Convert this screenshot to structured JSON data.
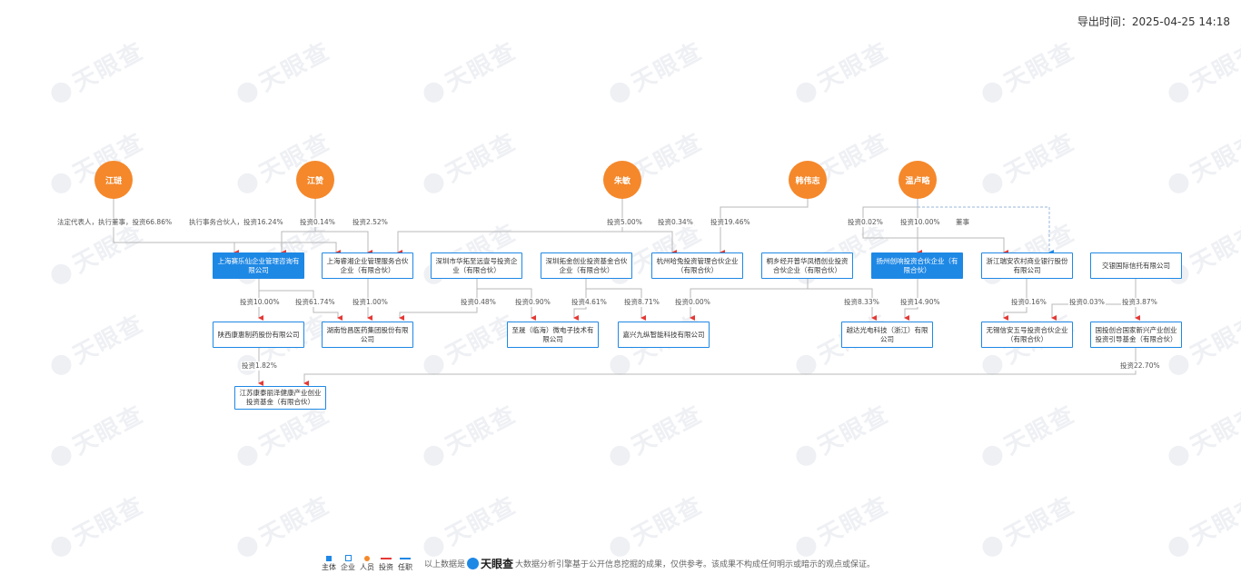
{
  "header": {
    "export_time": "导出时间：2025-04-25 14:18"
  },
  "watermark": {
    "text": "天眼查"
  },
  "persons": [
    {
      "name": "江琎"
    },
    {
      "name": "江赞"
    },
    {
      "name": "朱敏"
    },
    {
      "name": "韩伟志"
    },
    {
      "name": "温卢略"
    }
  ],
  "companies": [
    {
      "name": "上海赛乐仙企业管理咨询有限公司"
    },
    {
      "name": "上海睿湘企业管理服务合伙企业（有限合伙）"
    },
    {
      "name": "深圳市华拓至远壹号投资企业（有限合伙）"
    },
    {
      "name": "深圳拓金创业投资基金合伙企业（有限合伙）"
    },
    {
      "name": "杭州哈兔投资管理合伙企业（有限合伙）"
    },
    {
      "name": "桐乡经开普华凤栖创业投资合伙企业（有限合伙）"
    },
    {
      "name": "扬州创响投资合伙企业（有限合伙）"
    },
    {
      "name": "浙江瑞安农村商业银行股份有限公司"
    },
    {
      "name": "交银国际信托有限公司"
    },
    {
      "name": "陕西康惠制药股份有限公司"
    },
    {
      "name": "湖南怡昌医药集团股份有限公司"
    },
    {
      "name": "至晟（临海）微电子技术有限公司"
    },
    {
      "name": "嘉兴九纵智能科技有限公司"
    },
    {
      "name": "越达光电科技（浙江）有限公司"
    },
    {
      "name": "无锡信安五号投资合伙企业（有限合伙）"
    },
    {
      "name": "国投创合国家新兴产业创业投资引导基金（有限合伙）"
    },
    {
      "name": "江苏康泰丽泽健康产业创业投资基金（有限合伙）"
    }
  ],
  "edge_labels": [
    "法定代表人，执行董事，投资66.86%",
    "执行事务合伙人，投资16.24%",
    "投资0.14%",
    "投资2.52%",
    "投资5.00%",
    "投资0.34%",
    "投资19.46%",
    "投资0.02%",
    "投资10.00%",
    "董事",
    "投资10.00%",
    "投资61.74%",
    "投资1.00%",
    "投资0.48%",
    "投资0.90%",
    "投资4.61%",
    "投资8.71%",
    "投资0.00%",
    "投资8.33%",
    "投资14.90%",
    "投资0.16%",
    "投资0.03%",
    "投资3.87%",
    "投资1.82%",
    "投资22.70%"
  ],
  "footer": {
    "legend": [
      "主体",
      "企业",
      "人员",
      "投资",
      "任职"
    ],
    "prefix": "以上数据是",
    "brand": "天眼查",
    "disclaimer": "大数据分析引擎基于公开信息挖掘的成果，仅供参考。该成果不构成任何明示或暗示的观点或保证。"
  },
  "colors": {
    "person": "#f5882b",
    "company_border": "#1e88e5",
    "main_fill": "#1e88e5",
    "invest_line": "#e53935",
    "position_line": "#1e88e5"
  }
}
